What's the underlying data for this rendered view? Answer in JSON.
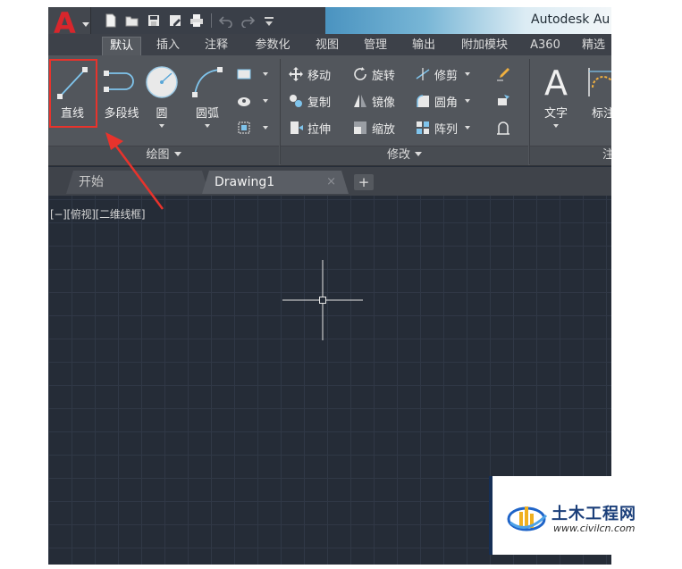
{
  "app": {
    "title": "Autodesk Au",
    "logo": "A"
  },
  "quick_access": {
    "icons": [
      "new-icon",
      "open-icon",
      "save-icon",
      "save-as-icon",
      "print-icon",
      "undo-icon",
      "redo-icon",
      "customize-icon"
    ]
  },
  "ribbon_tabs": [
    {
      "label": "默认",
      "active": true
    },
    {
      "label": "插入"
    },
    {
      "label": "注释"
    },
    {
      "label": "参数化"
    },
    {
      "label": "视图"
    },
    {
      "label": "管理"
    },
    {
      "label": "输出"
    },
    {
      "label": "附加模块"
    },
    {
      "label": "A360"
    },
    {
      "label": "精选"
    }
  ],
  "draw_panel": {
    "title": "绘图",
    "tools": {
      "line": "直线",
      "polyline": "多段线",
      "circle": "圆",
      "arc": "圆弧"
    }
  },
  "modify_panel": {
    "title": "修改",
    "tools": {
      "move": "移动",
      "rotate": "旋转",
      "trim": "修剪",
      "copy": "复制",
      "mirror": "镜像",
      "fillet": "圆角",
      "stretch": "拉伸",
      "scale": "缩放",
      "array": "阵列"
    }
  },
  "annotation_panel": {
    "title": "注释",
    "tools": {
      "text": "文字",
      "dimension": "标注"
    }
  },
  "file_tabs": [
    {
      "label": "开始"
    },
    {
      "label": "Drawing1",
      "active": true,
      "close": "×"
    }
  ],
  "new_tab_label": "+",
  "viewport": {
    "label": "[−][俯视][二维线框]"
  },
  "watermark": {
    "text": "土木工程网",
    "url": "www.civilcn.com"
  },
  "colors": {
    "highlight": "#e8332c",
    "canvas": "#252c37",
    "ribbon": "#52565c"
  }
}
